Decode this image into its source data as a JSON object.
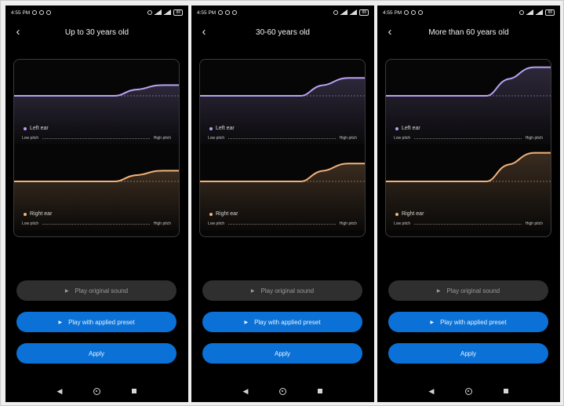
{
  "status_bar": {
    "time": "4:55 PM",
    "battery": "88"
  },
  "panels": [
    {
      "title": "Up to 30 years old",
      "rise": 0.06
    },
    {
      "title": "30-60 years old",
      "rise": 0.1
    },
    {
      "title": "More than 60 years old",
      "rise": 0.16
    }
  ],
  "labels": {
    "left_ear": "Left ear",
    "right_ear": "Right ear",
    "low_pitch": "Low pitch",
    "high_pitch": "High pitch"
  },
  "buttons": {
    "play_original": "Play original sound",
    "play_preset": "Play with applied preset",
    "apply": "Apply"
  },
  "colors": {
    "left_ear": "#b9a2f3",
    "right_ear": "#f2b27a",
    "accent": "#0b71d6"
  },
  "icons": {
    "back": "back-arrow-icon",
    "play": "play-icon",
    "nav_back": "nav-back-icon",
    "nav_home": "nav-home-icon",
    "nav_recents": "nav-recents-icon"
  }
}
